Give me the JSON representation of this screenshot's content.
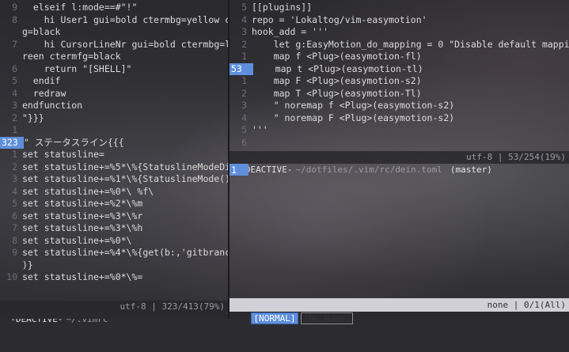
{
  "left_pane": {
    "lines": [
      {
        "num": "9",
        "text": "  elseif l:mode==#\"!\""
      },
      {
        "num": "8",
        "text": "    hi User1 gui=bold ctermbg=yellow ctermf"
      },
      {
        "num": "",
        "text": "g=black"
      },
      {
        "num": "7",
        "text": "    hi CursorLineNr gui=bold ctermbg=lightg"
      },
      {
        "num": "",
        "text": "reen ctermfg=black"
      },
      {
        "num": "6",
        "text": "    return \"[SHELL]\""
      },
      {
        "num": "5",
        "text": "  endif"
      },
      {
        "num": "4",
        "text": "  redraw"
      },
      {
        "num": "3",
        "text": "endfunction"
      },
      {
        "num": "2",
        "text": "\"}}}"
      },
      {
        "num": "1",
        "text": ""
      },
      {
        "num": "323",
        "text": "\" ステータスライン{{{",
        "current": true
      },
      {
        "num": "1",
        "text": "set statusline="
      },
      {
        "num": "2",
        "text": "set statusline+=%5*\\%{StatuslineModeDi()}"
      },
      {
        "num": "3",
        "text": "set statusline+=%1*\\%{StatuslineMode()}"
      },
      {
        "num": "4",
        "text": "set statusline+=%0*\\ %f\\"
      },
      {
        "num": "5",
        "text": "set statusline+=%2*\\%m"
      },
      {
        "num": "6",
        "text": "set statusline+=%3*\\%r"
      },
      {
        "num": "7",
        "text": "set statusline+=%3*\\%h"
      },
      {
        "num": "8",
        "text": "set statusline+=%0*\\"
      },
      {
        "num": "9",
        "text": "set statusline+=%4*\\%{get(b:,'gitbranch',''"
      },
      {
        "num": "",
        "text": ")}"
      },
      {
        "num": "10",
        "text": "set statusline+=%0*\\%="
      }
    ],
    "status": {
      "mode": "-DEACTIVE-",
      "file": "~/.vimrc",
      "right": "utf-8 | 323/413(79%)"
    }
  },
  "right_pane": {
    "lines": [
      {
        "num": "5",
        "text": "[[plugins]]"
      },
      {
        "num": "4",
        "text": "repo = 'Lokaltog/vim-easymotion'"
      },
      {
        "num": "3",
        "text": "hook_add = '''"
      },
      {
        "num": "2",
        "text": "    let g:EasyMotion_do_mapping = 0 \"Disable default mappings"
      },
      {
        "num": "1",
        "text": "    map f <Plug>(easymotion-fl)"
      },
      {
        "num": "53",
        "text": "    map t <Plug>(easymotion-tl)",
        "current": true
      },
      {
        "num": "1",
        "text": "    map F <Plug>(easymotion-s2)"
      },
      {
        "num": "2",
        "text": "    map T <Plug>(easymotion-Tl)"
      },
      {
        "num": "3",
        "text": "    \" noremap f <Plug>(easymotion-s2)"
      },
      {
        "num": "4",
        "text": "    \" noremap F <Plug>(easymotion-s2)"
      },
      {
        "num": "5",
        "text": "'''"
      },
      {
        "num": "6",
        "text": ""
      }
    ],
    "status": {
      "mode": "-DEACTIVE-",
      "file": "~/dotfiles/.vim/rc/dein.toml",
      "branch": "(master)",
      "right": "utf-8 | 53/254(19%)"
    },
    "lower_cursor_line": "1",
    "bottom_status": {
      "mode": "[NORMAL]",
      "file": "[No Name]",
      "right": "none | 0/1(All)"
    }
  },
  "colors": {
    "accent": "#5f8fdc",
    "background": "#2c2c30",
    "statusline_light": "#d0d0d6"
  }
}
